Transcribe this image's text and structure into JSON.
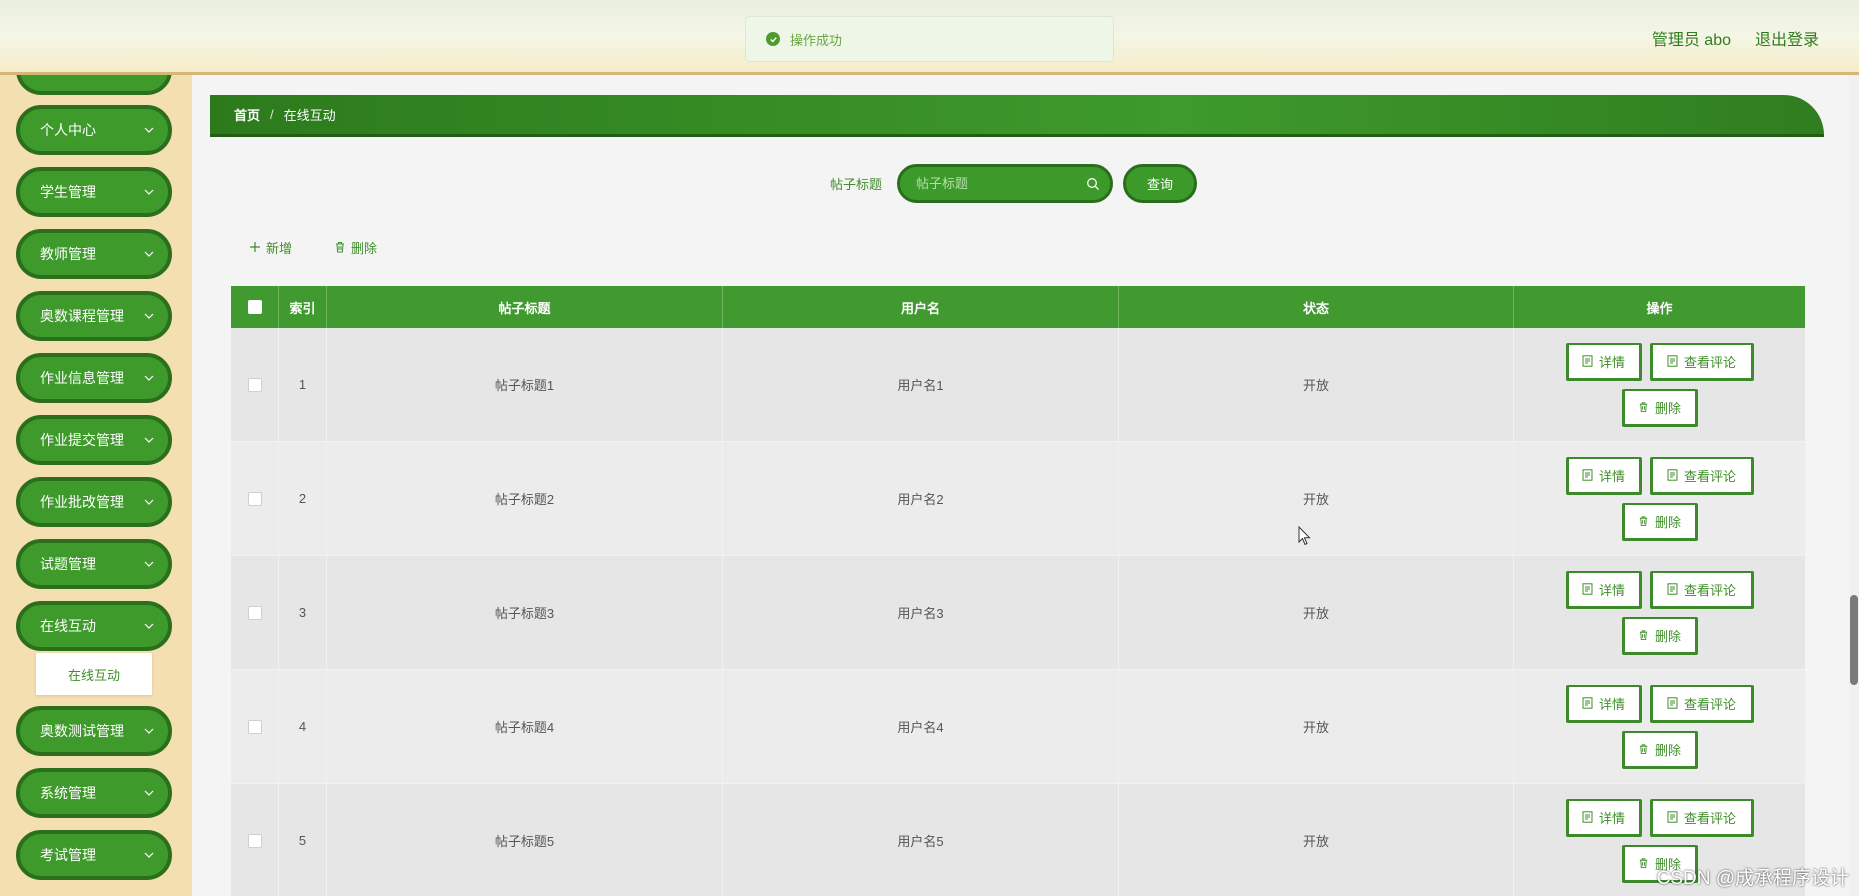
{
  "header": {
    "user": "管理员 abo",
    "logout": "退出登录"
  },
  "toast": {
    "message": "操作成功",
    "icon": "check-circle-icon"
  },
  "sidebar": {
    "items": [
      {
        "label": "个人中心"
      },
      {
        "label": "学生管理"
      },
      {
        "label": "教师管理"
      },
      {
        "label": "奥数课程管理"
      },
      {
        "label": "作业信息管理"
      },
      {
        "label": "作业提交管理"
      },
      {
        "label": "作业批改管理"
      },
      {
        "label": "试题管理"
      },
      {
        "label": "在线互动"
      },
      {
        "label": "奥数测试管理"
      },
      {
        "label": "系统管理"
      },
      {
        "label": "考试管理"
      }
    ],
    "submenu": {
      "label": "在线互动"
    }
  },
  "breadcrumb": {
    "home": "首页",
    "separator": "/",
    "current": "在线互动"
  },
  "search": {
    "label": "帖子标题",
    "placeholder": "帖子标题",
    "button": "查询"
  },
  "toolbar": {
    "add": "新增",
    "delete": "删除"
  },
  "table": {
    "headers": [
      "索引",
      "帖子标题",
      "用户名",
      "状态",
      "操作"
    ],
    "rows": [
      {
        "index": "1",
        "title": "帖子标题1",
        "user": "用户名1",
        "status": "开放"
      },
      {
        "index": "2",
        "title": "帖子标题2",
        "user": "用户名2",
        "status": "开放"
      },
      {
        "index": "3",
        "title": "帖子标题3",
        "user": "用户名3",
        "status": "开放"
      },
      {
        "index": "4",
        "title": "帖子标题4",
        "user": "用户名4",
        "status": "开放"
      },
      {
        "index": "5",
        "title": "帖子标题5",
        "user": "用户名5",
        "status": "开放"
      }
    ],
    "actions": {
      "detail": "详情",
      "comments": "查看评论",
      "delete": "删除"
    }
  },
  "watermark": "CSDN @成承程序设计",
  "colors": {
    "primary": "#3f9a2c",
    "primary_dark": "#2b6f1c",
    "sidebar_bg": "#f4dfb0"
  }
}
